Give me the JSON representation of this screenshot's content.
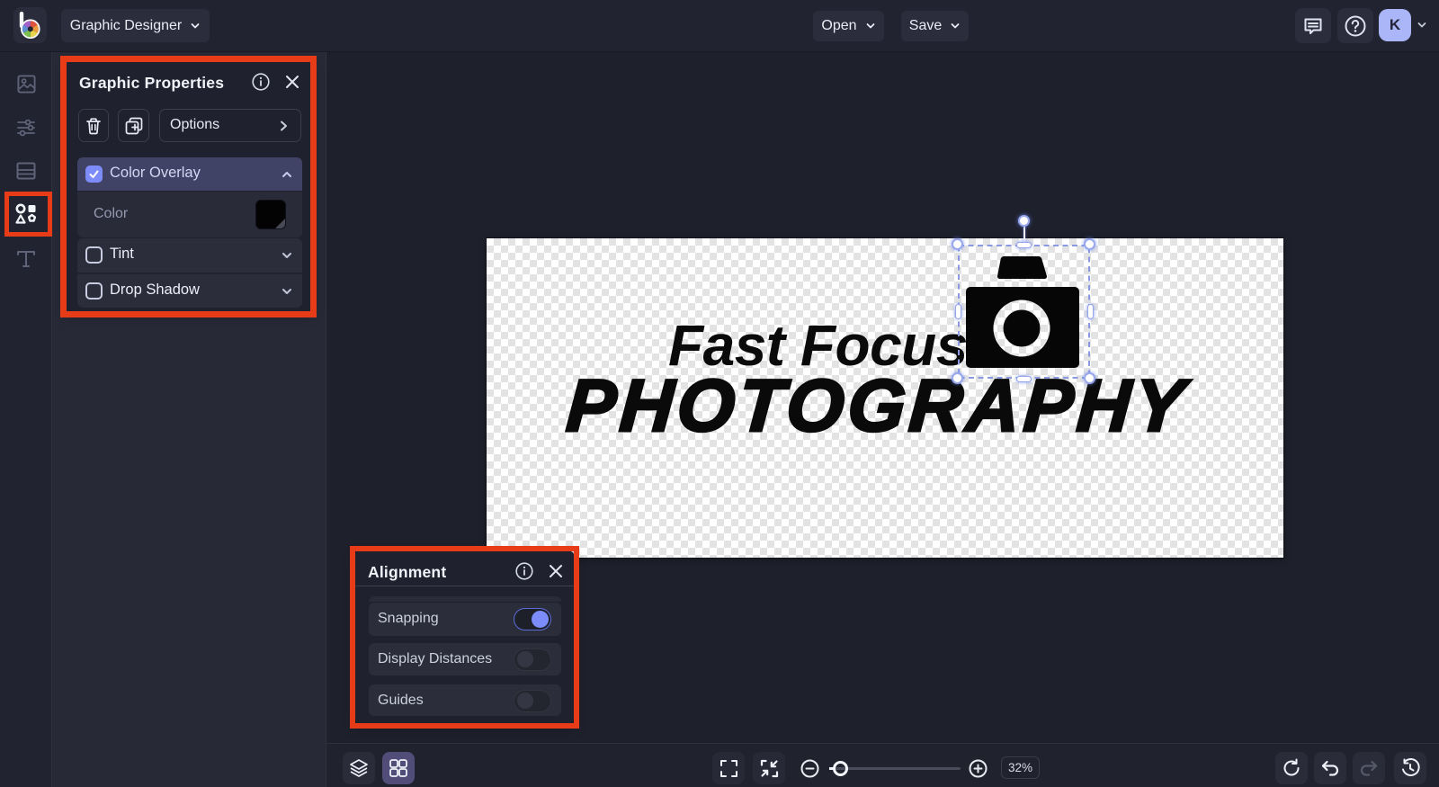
{
  "topbar": {
    "app_menu_label": "Graphic Designer",
    "open_label": "Open",
    "save_label": "Save",
    "avatar_initial": "K"
  },
  "sidebar": {
    "items": [
      {
        "icon": "image-icon",
        "active": false
      },
      {
        "icon": "adjustments-icon",
        "active": false
      },
      {
        "icon": "templates-icon",
        "active": false
      },
      {
        "icon": "graphics-icon",
        "active": true,
        "annotated": true
      },
      {
        "icon": "text-icon",
        "active": false
      }
    ]
  },
  "properties_panel": {
    "title": "Graphic Properties",
    "options_label": "Options",
    "rows": {
      "color_overlay": {
        "label": "Color Overlay",
        "checked": true,
        "expanded": true
      },
      "color": {
        "label": "Color",
        "value": "#000000"
      },
      "tint": {
        "label": "Tint",
        "checked": false
      },
      "drop_shadow": {
        "label": "Drop Shadow",
        "checked": false
      }
    }
  },
  "alignment_panel": {
    "title": "Alignment",
    "toggles": [
      {
        "label": "Snapping",
        "on": true
      },
      {
        "label": "Display Distances",
        "on": false
      },
      {
        "label": "Guides",
        "on": false
      }
    ]
  },
  "canvas": {
    "logo_text_primary": "Fast Focus",
    "logo_text_secondary": "PHOTOGRAPHY"
  },
  "toolbar": {
    "zoom_percent": "32%"
  },
  "colors": {
    "accent_periwinkle": "#7d8cf8",
    "annotation_red": "#e73c17",
    "selection_blue": "#8a99e2",
    "swatch_color": "#000000"
  }
}
